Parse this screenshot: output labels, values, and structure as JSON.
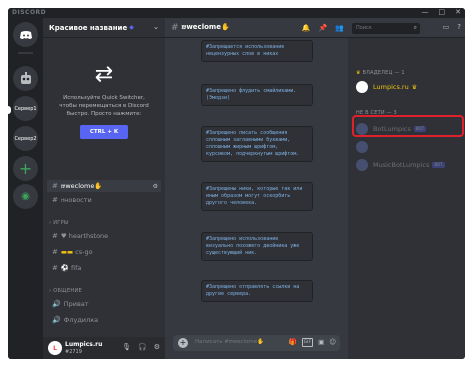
{
  "titlebar": {
    "app_name": "DISCORD",
    "controls": [
      "—",
      "□",
      "✕"
    ]
  },
  "servers": [
    {
      "label": "",
      "icon": "discord-logo-icon"
    },
    {
      "label": "",
      "icon": "bot-avatar-icon"
    },
    {
      "label": "Сервер1"
    },
    {
      "label": "Сервер2"
    }
  ],
  "server": {
    "name": "Красивое название",
    "dropdown_icon": "⌄"
  },
  "quick_switcher": {
    "text": "Используйте Quick Switcher, чтобы перемещаться в Discord быстро. Просто нажмите:",
    "button": "CTRL + K"
  },
  "channels": {
    "welcome": "𝔴weclome✋",
    "news": "𝔫новости",
    "cat_games": "ИГРЫ",
    "hearthstone": "hearthstone",
    "csgo": "cs-go",
    "fifa": "fifa",
    "cat_social": "ОБЩЕНИЕ",
    "privet": "Приват",
    "fludilka": "Флудилка"
  },
  "user": {
    "name": "Lumpics.ru",
    "tag": "#2719"
  },
  "main": {
    "channel_name": "𝔴weclome✋",
    "placeholder": "Написать #𝔴weclome✋",
    "messages": [
      "#Запрещается использование нецензурных слов в никах",
      "#Запрещено флудить смайликами.(Эмодзи)",
      "#Запрещено писать сообщения сплошным заглавными буквами, сплошным жирным шрифтом, курсивом, подчеркнутым шрифтом.",
      "#Запрещены ники, которые так или иным образом могут оскорбить другого человека.",
      "#Запрещено использование визуально похожего двойника уже существующий ник.",
      "#Запрещено отправлять ссылки на другие сервера."
    ]
  },
  "members": {
    "search_placeholder": "Поиск",
    "owner_category": "ВЛАДЕЛЕЦ — 1",
    "owner_name": "Lumpics.ru",
    "offline_category": "НЕ В СЕТИ — 3",
    "offline": [
      {
        "name": "BotLumpics",
        "badge": "BOT"
      },
      {
        "name": "",
        "badge": ""
      },
      {
        "name": "MusicBotLumpics",
        "badge": "BOT"
      }
    ]
  },
  "colors": {
    "accent": "#5865f2",
    "online_green": "#3ba55c",
    "owner_name_color": "#f1c40f",
    "highlight_red": "#e0202a"
  }
}
